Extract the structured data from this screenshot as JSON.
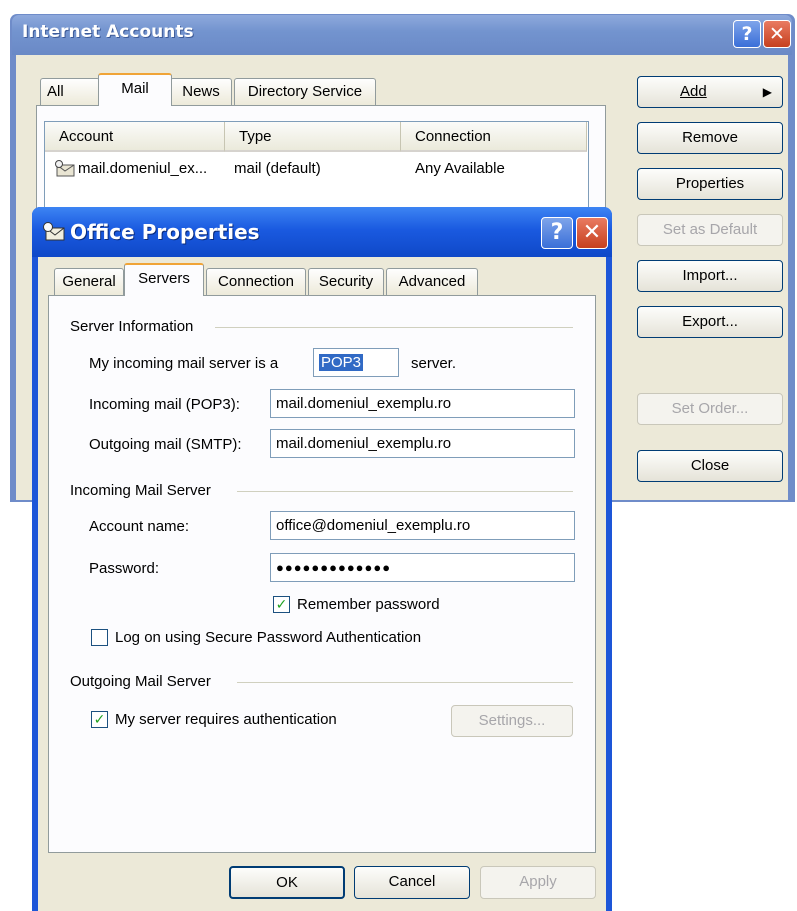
{
  "internet_accounts": {
    "title": "Internet Accounts",
    "tabs": [
      "All",
      "Mail",
      "News",
      "Directory Service"
    ],
    "active_tab": "Mail",
    "columns": [
      "Account",
      "Type",
      "Connection"
    ],
    "rows": [
      {
        "account": "mail.domeniul_ex...",
        "type": "mail (default)",
        "connection": "Any Available"
      }
    ],
    "buttons": {
      "add": "Add",
      "remove": "Remove",
      "properties": "Properties",
      "set_default": "Set as Default",
      "import": "Import...",
      "export": "Export...",
      "set_order": "Set Order...",
      "close": "Close"
    }
  },
  "office_properties": {
    "title": "Office Properties",
    "tabs": [
      "General",
      "Servers",
      "Connection",
      "Security",
      "Advanced"
    ],
    "active_tab": "Servers",
    "server_info": {
      "group_label": "Server Information",
      "incoming_type_prefix": "My incoming mail server is a",
      "incoming_type_value": "POP3",
      "incoming_type_suffix": "server.",
      "incoming_label": "Incoming mail (POP3):",
      "incoming_value": "mail.domeniul_exemplu.ro",
      "outgoing_label": "Outgoing mail (SMTP):",
      "outgoing_value": "mail.domeniul_exemplu.ro"
    },
    "incoming_server": {
      "group_label": "Incoming Mail Server",
      "account_label": "Account name:",
      "account_value": "office@domeniul_exemplu.ro",
      "password_label": "Password:",
      "password_value": "●●●●●●●●●●●●●",
      "remember_label": "Remember password",
      "remember_checked": true,
      "spa_label": "Log on using Secure Password Authentication",
      "spa_checked": false
    },
    "outgoing_server": {
      "group_label": "Outgoing Mail Server",
      "auth_label": "My server requires authentication",
      "auth_checked": true,
      "settings_button": "Settings..."
    },
    "buttons": {
      "ok": "OK",
      "cancel": "Cancel",
      "apply": "Apply"
    }
  },
  "icons": {
    "help": "?",
    "close": "✕",
    "check": "✓",
    "arrow_right": "▶"
  },
  "colors": {
    "xp_blue_title": "#1a5ae0",
    "inactive_title": "#7394cf",
    "dialog_bg": "#ece9d8",
    "tab_accent": "#f0a437"
  }
}
